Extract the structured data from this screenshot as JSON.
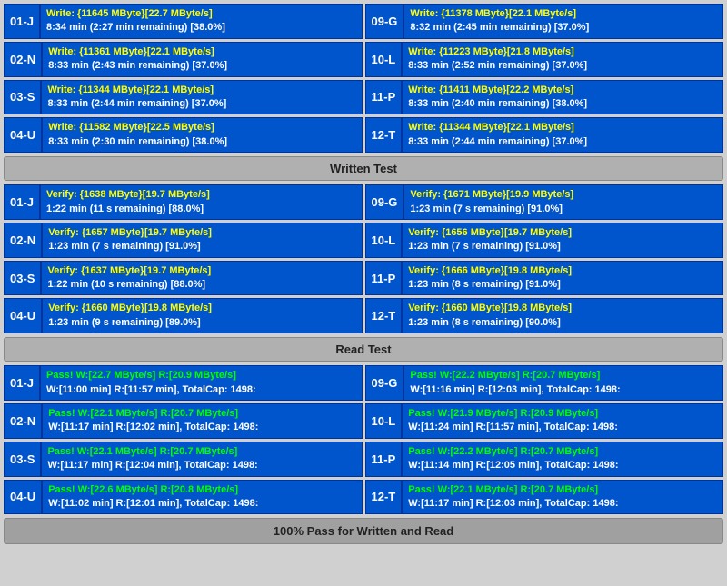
{
  "write_section": {
    "rows": [
      {
        "left": {
          "label": "01-J",
          "line1": "Write: {11645 MByte}[22.7 MByte/s]",
          "line2": "8:34 min (2:27 min remaining)  [38.0%]"
        },
        "right": {
          "label": "09-G",
          "line1": "Write: {11378 MByte}[22.1 MByte/s]",
          "line2": "8:32 min (2:45 min remaining)  [37.0%]"
        }
      },
      {
        "left": {
          "label": "02-N",
          "line1": "Write: {11361 MByte}[22.1 MByte/s]",
          "line2": "8:33 min (2:43 min remaining)  [37.0%]"
        },
        "right": {
          "label": "10-L",
          "line1": "Write: {11223 MByte}[21.8 MByte/s]",
          "line2": "8:33 min (2:52 min remaining)  [37.0%]"
        }
      },
      {
        "left": {
          "label": "03-S",
          "line1": "Write: {11344 MByte}[22.1 MByte/s]",
          "line2": "8:33 min (2:44 min remaining)  [37.0%]"
        },
        "right": {
          "label": "11-P",
          "line1": "Write: {11411 MByte}[22.2 MByte/s]",
          "line2": "8:33 min (2:40 min remaining)  [38.0%]"
        }
      },
      {
        "left": {
          "label": "04-U",
          "line1": "Write: {11582 MByte}[22.5 MByte/s]",
          "line2": "8:33 min (2:30 min remaining)  [38.0%]"
        },
        "right": {
          "label": "12-T",
          "line1": "Write: {11344 MByte}[22.1 MByte/s]",
          "line2": "8:33 min (2:44 min remaining)  [37.0%]"
        }
      }
    ],
    "header": "Written Test"
  },
  "verify_section": {
    "rows": [
      {
        "left": {
          "label": "01-J",
          "line1": "Verify: {1638 MByte}[19.7 MByte/s]",
          "line2": "1:22 min (11 s remaining)   [88.0%]"
        },
        "right": {
          "label": "09-G",
          "line1": "Verify: {1671 MByte}[19.9 MByte/s]",
          "line2": "1:23 min (7 s remaining)   [91.0%]"
        }
      },
      {
        "left": {
          "label": "02-N",
          "line1": "Verify: {1657 MByte}[19.7 MByte/s]",
          "line2": "1:23 min (7 s remaining)   [91.0%]"
        },
        "right": {
          "label": "10-L",
          "line1": "Verify: {1656 MByte}[19.7 MByte/s]",
          "line2": "1:23 min (7 s remaining)   [91.0%]"
        }
      },
      {
        "left": {
          "label": "03-S",
          "line1": "Verify: {1637 MByte}[19.7 MByte/s]",
          "line2": "1:22 min (10 s remaining)   [88.0%]"
        },
        "right": {
          "label": "11-P",
          "line1": "Verify: {1666 MByte}[19.8 MByte/s]",
          "line2": "1:23 min (8 s remaining)   [91.0%]"
        }
      },
      {
        "left": {
          "label": "04-U",
          "line1": "Verify: {1660 MByte}[19.8 MByte/s]",
          "line2": "1:23 min (9 s remaining)   [89.0%]"
        },
        "right": {
          "label": "12-T",
          "line1": "Verify: {1660 MByte}[19.8 MByte/s]",
          "line2": "1:23 min (8 s remaining)   [90.0%]"
        }
      }
    ],
    "header": "Read Test"
  },
  "pass_section": {
    "rows": [
      {
        "left": {
          "label": "01-J",
          "line1": "Pass! W:[22.7 MByte/s] R:[20.9 MByte/s]",
          "line2": "W:[11:00 min] R:[11:57 min], TotalCap: 1498:"
        },
        "right": {
          "label": "09-G",
          "line1": "Pass! W:[22.2 MByte/s] R:[20.7 MByte/s]",
          "line2": "W:[11:16 min] R:[12:03 min], TotalCap: 1498:"
        }
      },
      {
        "left": {
          "label": "02-N",
          "line1": "Pass! W:[22.1 MByte/s] R:[20.7 MByte/s]",
          "line2": "W:[11:17 min] R:[12:02 min], TotalCap: 1498:"
        },
        "right": {
          "label": "10-L",
          "line1": "Pass! W:[21.9 MByte/s] R:[20.9 MByte/s]",
          "line2": "W:[11:24 min] R:[11:57 min], TotalCap: 1498:"
        }
      },
      {
        "left": {
          "label": "03-S",
          "line1": "Pass! W:[22.1 MByte/s] R:[20.7 MByte/s]",
          "line2": "W:[11:17 min] R:[12:04 min], TotalCap: 1498:"
        },
        "right": {
          "label": "11-P",
          "line1": "Pass! W:[22.2 MByte/s] R:[20.7 MByte/s]",
          "line2": "W:[11:14 min] R:[12:05 min], TotalCap: 1498:"
        }
      },
      {
        "left": {
          "label": "04-U",
          "line1": "Pass! W:[22.6 MByte/s] R:[20.8 MByte/s]",
          "line2": "W:[11:02 min] R:[12:01 min], TotalCap: 1498:"
        },
        "right": {
          "label": "12-T",
          "line1": "Pass! W:[22.1 MByte/s] R:[20.7 MByte/s]",
          "line2": "W:[11:17 min] R:[12:03 min], TotalCap: 1498:"
        }
      }
    ],
    "footer": "100% Pass for Written and Read"
  }
}
